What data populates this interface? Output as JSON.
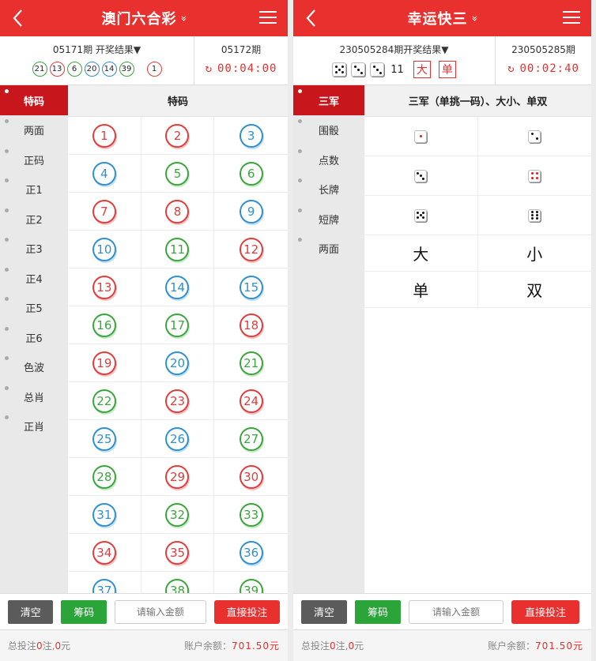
{
  "lhc": {
    "title": "澳门六合彩",
    "title_chevron": "»",
    "prev_issue": "05171期 开奖结果▼",
    "next_issue": "05172期",
    "timer": "00:04:00",
    "result_balls": [
      {
        "num": "21",
        "color": "green"
      },
      {
        "num": "13",
        "color": "red"
      },
      {
        "num": "6",
        "color": "green"
      },
      {
        "num": "20",
        "color": "blue"
      },
      {
        "num": "14",
        "color": "blue"
      },
      {
        "num": "39",
        "color": "green"
      }
    ],
    "special_ball": {
      "num": "1",
      "color": "red"
    },
    "sidebar": [
      "特码",
      "两面",
      "正码",
      "正1",
      "正2",
      "正3",
      "正4",
      "正5",
      "正6",
      "色波",
      "总肖",
      "正肖"
    ],
    "content_title": "特码",
    "numbers": [
      {
        "n": "1",
        "c": "red"
      },
      {
        "n": "2",
        "c": "red"
      },
      {
        "n": "3",
        "c": "blue"
      },
      {
        "n": "4",
        "c": "blue"
      },
      {
        "n": "5",
        "c": "green"
      },
      {
        "n": "6",
        "c": "green"
      },
      {
        "n": "7",
        "c": "red"
      },
      {
        "n": "8",
        "c": "red"
      },
      {
        "n": "9",
        "c": "blue"
      },
      {
        "n": "10",
        "c": "blue"
      },
      {
        "n": "11",
        "c": "green"
      },
      {
        "n": "12",
        "c": "red"
      },
      {
        "n": "13",
        "c": "red"
      },
      {
        "n": "14",
        "c": "blue"
      },
      {
        "n": "15",
        "c": "blue"
      },
      {
        "n": "16",
        "c": "green"
      },
      {
        "n": "17",
        "c": "green"
      },
      {
        "n": "18",
        "c": "red"
      },
      {
        "n": "19",
        "c": "red"
      },
      {
        "n": "20",
        "c": "blue"
      },
      {
        "n": "21",
        "c": "green"
      },
      {
        "n": "22",
        "c": "green"
      },
      {
        "n": "23",
        "c": "red"
      },
      {
        "n": "24",
        "c": "red"
      },
      {
        "n": "25",
        "c": "blue"
      },
      {
        "n": "26",
        "c": "blue"
      },
      {
        "n": "27",
        "c": "green"
      },
      {
        "n": "28",
        "c": "green"
      },
      {
        "n": "29",
        "c": "red"
      },
      {
        "n": "30",
        "c": "red"
      },
      {
        "n": "31",
        "c": "blue"
      },
      {
        "n": "32",
        "c": "green"
      },
      {
        "n": "33",
        "c": "green"
      },
      {
        "n": "34",
        "c": "red"
      },
      {
        "n": "35",
        "c": "red"
      },
      {
        "n": "36",
        "c": "blue"
      },
      {
        "n": "37",
        "c": "blue"
      },
      {
        "n": "38",
        "c": "green"
      },
      {
        "n": "39",
        "c": "green"
      }
    ],
    "clear_label": "清空",
    "chips_label": "筹码",
    "amount_placeholder": "请输入金额",
    "bet_label": "直接投注",
    "total_prefix": "总投注",
    "total_count": "0",
    "total_mid": "注,",
    "total_amount": "0",
    "total_suffix": "元",
    "balance_label": "账户余额：",
    "balance": "701.50元"
  },
  "k3": {
    "title": "幸运快三",
    "title_chevron": "»",
    "prev_issue": "230505284期开奖结果▼",
    "next_issue": "230505285期",
    "timer": "00:02:40",
    "dice": [
      5,
      3,
      3
    ],
    "sum": "11",
    "tag_big": "大",
    "tag_odd": "单",
    "sidebar": [
      "三军",
      "围骰",
      "点数",
      "长牌",
      "短牌",
      "两面"
    ],
    "content_title": "三军（单挑一码）、大小、单双",
    "face_cells": [
      1,
      2,
      3,
      4,
      5,
      6
    ],
    "text_cells": [
      "大",
      "小",
      "单",
      "双"
    ],
    "clear_label": "清空",
    "chips_label": "筹码",
    "amount_placeholder": "请输入金额",
    "bet_label": "直接投注",
    "total_prefix": "总投注",
    "total_count": "0",
    "total_mid": "注,",
    "total_amount": "0",
    "total_suffix": "元",
    "balance_label": "账户余额：",
    "balance": "701.50元"
  },
  "colors": {
    "red": "#e23c3c",
    "green": "#3aa53a",
    "blue": "#2f8fd0",
    "brand": "#e8302e",
    "active": "#c8161d"
  }
}
